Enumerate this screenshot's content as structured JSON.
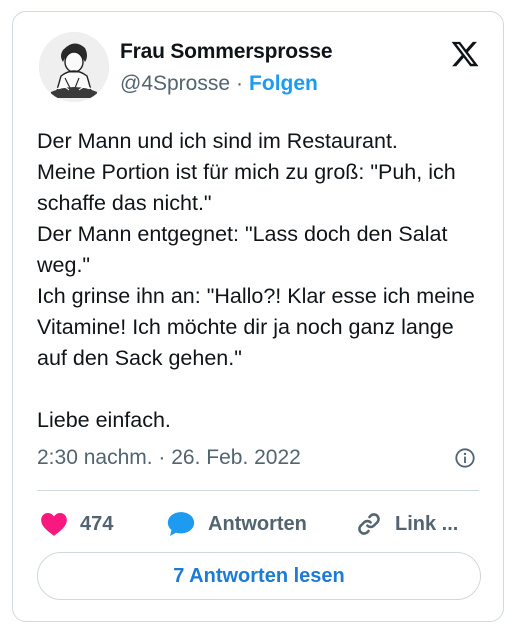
{
  "user": {
    "display_name": "Frau Sommersprosse",
    "handle": "@4Sprosse",
    "separator": "·",
    "follow_label": "Folgen"
  },
  "tweet": {
    "text": "Der Mann und ich sind im Restaurant.\nMeine Portion ist für mich zu groß: \"Puh, ich schaffe das nicht.\"\nDer Mann entgegnet: \"Lass doch den Salat weg.\"\nIch grinse ihn an: \"Hallo?! Klar esse ich meine Vitamine! Ich möchte dir ja noch ganz lange auf den Sack gehen.\"\n\nLiebe einfach.",
    "timestamp": "2:30 nachm. · 26. Feb. 2022"
  },
  "actions": {
    "like_count": "474",
    "reply_label": "Antworten",
    "link_label": "Link ..."
  },
  "read_replies_label": "7 Antworten lesen",
  "icons": {
    "brand": "x-logo-icon",
    "info": "info-icon",
    "like": "heart-icon",
    "reply": "speech-bubble-icon",
    "link": "link-icon"
  },
  "colors": {
    "like": "#f91880",
    "reply": "#1d9bf0",
    "follow": "#1d9bf0",
    "read_button_text": "#1d7bd6",
    "muted_text": "#536471"
  }
}
